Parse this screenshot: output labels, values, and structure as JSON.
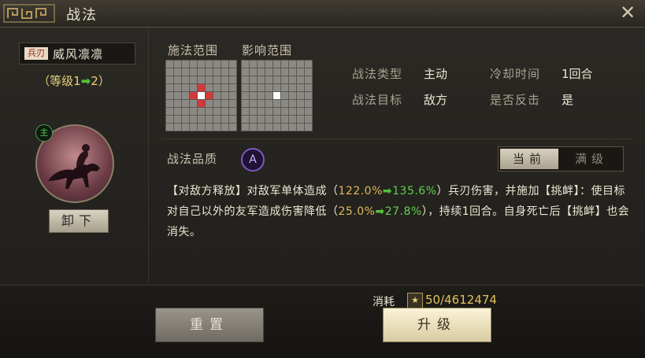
{
  "window": {
    "title": "战法"
  },
  "skill": {
    "type_tag": "兵刃",
    "name": "威风凛凛",
    "level": {
      "prefix": "（等级",
      "from": "1",
      "arrow": "➡",
      "to": "2",
      "suffix": "）"
    },
    "hero_badge": "主",
    "unload_label": "卸下"
  },
  "ranges": {
    "cast_label": "施法范围",
    "effect_label": "影响范围",
    "cast_grid": {
      "size": 9,
      "white": [
        [
          4,
          4
        ]
      ],
      "red": [
        [
          3,
          4
        ],
        [
          4,
          3
        ],
        [
          4,
          5
        ],
        [
          5,
          4
        ]
      ]
    },
    "effect_grid": {
      "size": 9,
      "white": [
        [
          4,
          4
        ]
      ],
      "red": []
    }
  },
  "info": {
    "type_label": "战法类型",
    "type_value": "主动",
    "cooldown_label": "冷却时间",
    "cooldown_value": "1回合",
    "target_label": "战法目标",
    "target_value": "敌方",
    "counter_label": "是否反击",
    "counter_value": "是"
  },
  "quality": {
    "label": "战法品质",
    "grade": "A"
  },
  "toggle": {
    "current": "当前",
    "max": "满级"
  },
  "description": {
    "p1": "【对敌方释放】对敌军单体造成（",
    "v1_from": "122.0%",
    "arrow": "➡",
    "v1_to": "135.6%",
    "p2": "）兵刃伤害，并施加【挑衅】：使目标对自己以外的友军造成伤害降低（",
    "v2_from": "25.0%",
    "v2_to": "27.8%",
    "p3": "），持续1回合。自身死亡后【挑衅】也会消失。"
  },
  "cost": {
    "label": "消耗",
    "icon": "★",
    "value": "50/4612474"
  },
  "buttons": {
    "reset": "重置",
    "upgrade": "升级"
  },
  "colors": {
    "accent_gold": "#e4c25c",
    "green": "#5fcf4f",
    "red_cell": "#d2393a",
    "quality_purple": "#7e57c2"
  }
}
